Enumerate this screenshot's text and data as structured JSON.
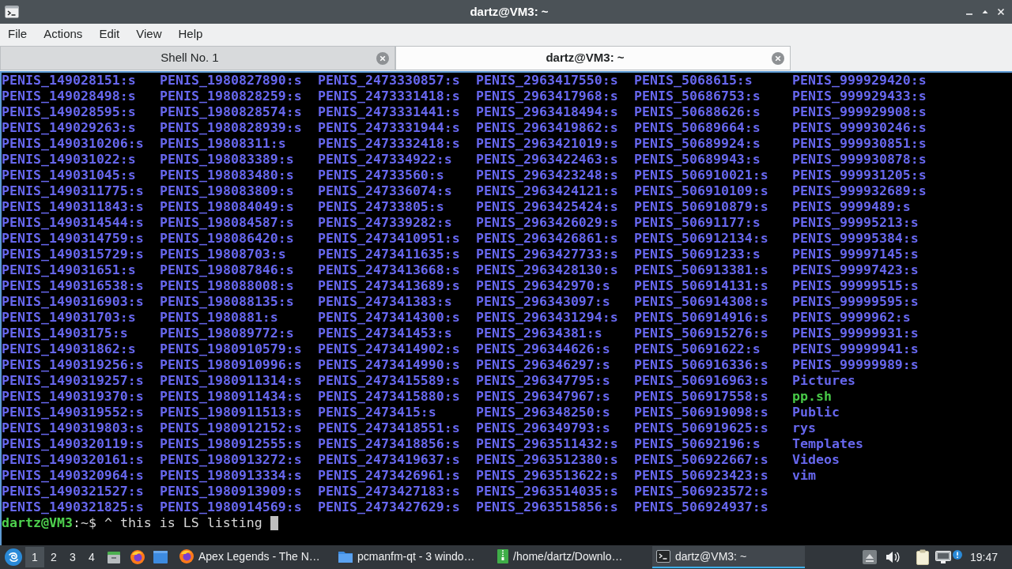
{
  "window": {
    "title": "dartz@VM3: ~"
  },
  "menu": [
    "File",
    "Actions",
    "Edit",
    "View",
    "Help"
  ],
  "tabs": [
    {
      "label": "Shell No. 1",
      "selected": false
    },
    {
      "label": "dartz@VM3: ~",
      "selected": true
    }
  ],
  "terminal": {
    "columns": [
      [
        {
          "name": "PENIS_149028151:s",
          "kind": "dir"
        },
        {
          "name": "PENIS_149028498:s",
          "kind": "dir"
        },
        {
          "name": "PENIS_149028595:s",
          "kind": "dir"
        },
        {
          "name": "PENIS_149029263:s",
          "kind": "dir"
        },
        {
          "name": "PENIS_1490310206:s",
          "kind": "dir"
        },
        {
          "name": "PENIS_149031022:s",
          "kind": "dir"
        },
        {
          "name": "PENIS_149031045:s",
          "kind": "dir"
        },
        {
          "name": "PENIS_1490311775:s",
          "kind": "dir"
        },
        {
          "name": "PENIS_1490311843:s",
          "kind": "dir"
        },
        {
          "name": "PENIS_1490314544:s",
          "kind": "dir"
        },
        {
          "name": "PENIS_1490314759:s",
          "kind": "dir"
        },
        {
          "name": "PENIS_1490315729:s",
          "kind": "dir"
        },
        {
          "name": "PENIS_149031651:s",
          "kind": "dir"
        },
        {
          "name": "PENIS_1490316538:s",
          "kind": "dir"
        },
        {
          "name": "PENIS_1490316903:s",
          "kind": "dir"
        },
        {
          "name": "PENIS_149031703:s",
          "kind": "dir"
        },
        {
          "name": "PENIS_14903175:s",
          "kind": "dir"
        },
        {
          "name": "PENIS_149031862:s",
          "kind": "dir"
        },
        {
          "name": "PENIS_1490319256:s",
          "kind": "dir"
        },
        {
          "name": "PENIS_1490319257:s",
          "kind": "dir"
        },
        {
          "name": "PENIS_1490319370:s",
          "kind": "dir"
        },
        {
          "name": "PENIS_1490319552:s",
          "kind": "dir"
        },
        {
          "name": "PENIS_1490319803:s",
          "kind": "dir"
        },
        {
          "name": "PENIS_1490320119:s",
          "kind": "dir"
        },
        {
          "name": "PENIS_1490320161:s",
          "kind": "dir"
        },
        {
          "name": "PENIS_1490320964:s",
          "kind": "dir"
        },
        {
          "name": "PENIS_1490321527:s",
          "kind": "dir"
        },
        {
          "name": "PENIS_1490321825:s",
          "kind": "dir"
        }
      ],
      [
        {
          "name": "PENIS_1980827890:s",
          "kind": "dir"
        },
        {
          "name": "PENIS_1980828259:s",
          "kind": "dir"
        },
        {
          "name": "PENIS_1980828574:s",
          "kind": "dir"
        },
        {
          "name": "PENIS_1980828939:s",
          "kind": "dir"
        },
        {
          "name": "PENIS_19808311:s",
          "kind": "dir"
        },
        {
          "name": "PENIS_198083389:s",
          "kind": "dir"
        },
        {
          "name": "PENIS_198083480:s",
          "kind": "dir"
        },
        {
          "name": "PENIS_198083809:s",
          "kind": "dir"
        },
        {
          "name": "PENIS_198084049:s",
          "kind": "dir"
        },
        {
          "name": "PENIS_198084587:s",
          "kind": "dir"
        },
        {
          "name": "PENIS_198086420:s",
          "kind": "dir"
        },
        {
          "name": "PENIS_19808703:s",
          "kind": "dir"
        },
        {
          "name": "PENIS_198087846:s",
          "kind": "dir"
        },
        {
          "name": "PENIS_198088008:s",
          "kind": "dir"
        },
        {
          "name": "PENIS_198088135:s",
          "kind": "dir"
        },
        {
          "name": "PENIS_1980881:s",
          "kind": "dir"
        },
        {
          "name": "PENIS_198089772:s",
          "kind": "dir"
        },
        {
          "name": "PENIS_1980910579:s",
          "kind": "dir"
        },
        {
          "name": "PENIS_1980910996:s",
          "kind": "dir"
        },
        {
          "name": "PENIS_1980911314:s",
          "kind": "dir"
        },
        {
          "name": "PENIS_1980911434:s",
          "kind": "dir"
        },
        {
          "name": "PENIS_1980911513:s",
          "kind": "dir"
        },
        {
          "name": "PENIS_1980912152:s",
          "kind": "dir"
        },
        {
          "name": "PENIS_1980912555:s",
          "kind": "dir"
        },
        {
          "name": "PENIS_1980913272:s",
          "kind": "dir"
        },
        {
          "name": "PENIS_1980913334:s",
          "kind": "dir"
        },
        {
          "name": "PENIS_1980913909:s",
          "kind": "dir"
        },
        {
          "name": "PENIS_1980914569:s",
          "kind": "dir"
        }
      ],
      [
        {
          "name": "PENIS_2473330857:s",
          "kind": "dir"
        },
        {
          "name": "PENIS_2473331418:s",
          "kind": "dir"
        },
        {
          "name": "PENIS_2473331441:s",
          "kind": "dir"
        },
        {
          "name": "PENIS_2473331944:s",
          "kind": "dir"
        },
        {
          "name": "PENIS_2473332418:s",
          "kind": "dir"
        },
        {
          "name": "PENIS_247334922:s",
          "kind": "dir"
        },
        {
          "name": "PENIS_24733560:s",
          "kind": "dir"
        },
        {
          "name": "PENIS_247336074:s",
          "kind": "dir"
        },
        {
          "name": "PENIS_24733805:s",
          "kind": "dir"
        },
        {
          "name": "PENIS_247339282:s",
          "kind": "dir"
        },
        {
          "name": "PENIS_2473410951:s",
          "kind": "dir"
        },
        {
          "name": "PENIS_2473411635:s",
          "kind": "dir"
        },
        {
          "name": "PENIS_2473413668:s",
          "kind": "dir"
        },
        {
          "name": "PENIS_2473413689:s",
          "kind": "dir"
        },
        {
          "name": "PENIS_247341383:s",
          "kind": "dir"
        },
        {
          "name": "PENIS_2473414300:s",
          "kind": "dir"
        },
        {
          "name": "PENIS_247341453:s",
          "kind": "dir"
        },
        {
          "name": "PENIS_2473414902:s",
          "kind": "dir"
        },
        {
          "name": "PENIS_2473414990:s",
          "kind": "dir"
        },
        {
          "name": "PENIS_2473415589:s",
          "kind": "dir"
        },
        {
          "name": "PENIS_2473415880:s",
          "kind": "dir"
        },
        {
          "name": "PENIS_2473415:s",
          "kind": "dir"
        },
        {
          "name": "PENIS_2473418551:s",
          "kind": "dir"
        },
        {
          "name": "PENIS_2473418856:s",
          "kind": "dir"
        },
        {
          "name": "PENIS_2473419637:s",
          "kind": "dir"
        },
        {
          "name": "PENIS_2473426961:s",
          "kind": "dir"
        },
        {
          "name": "PENIS_2473427183:s",
          "kind": "dir"
        },
        {
          "name": "PENIS_2473427629:s",
          "kind": "dir"
        }
      ],
      [
        {
          "name": "PENIS_2963417550:s",
          "kind": "dir"
        },
        {
          "name": "PENIS_2963417968:s",
          "kind": "dir"
        },
        {
          "name": "PENIS_2963418494:s",
          "kind": "dir"
        },
        {
          "name": "PENIS_2963419862:s",
          "kind": "dir"
        },
        {
          "name": "PENIS_2963421019:s",
          "kind": "dir"
        },
        {
          "name": "PENIS_2963422463:s",
          "kind": "dir"
        },
        {
          "name": "PENIS_2963423248:s",
          "kind": "dir"
        },
        {
          "name": "PENIS_2963424121:s",
          "kind": "dir"
        },
        {
          "name": "PENIS_2963425424:s",
          "kind": "dir"
        },
        {
          "name": "PENIS_2963426029:s",
          "kind": "dir"
        },
        {
          "name": "PENIS_2963426861:s",
          "kind": "dir"
        },
        {
          "name": "PENIS_2963427733:s",
          "kind": "dir"
        },
        {
          "name": "PENIS_2963428130:s",
          "kind": "dir"
        },
        {
          "name": "PENIS_296342970:s",
          "kind": "dir"
        },
        {
          "name": "PENIS_296343097:s",
          "kind": "dir"
        },
        {
          "name": "PENIS_2963431294:s",
          "kind": "dir"
        },
        {
          "name": "PENIS_29634381:s",
          "kind": "dir"
        },
        {
          "name": "PENIS_296344626:s",
          "kind": "dir"
        },
        {
          "name": "PENIS_296346297:s",
          "kind": "dir"
        },
        {
          "name": "PENIS_296347795:s",
          "kind": "dir"
        },
        {
          "name": "PENIS_296347967:s",
          "kind": "dir"
        },
        {
          "name": "PENIS_296348250:s",
          "kind": "dir"
        },
        {
          "name": "PENIS_296349793:s",
          "kind": "dir"
        },
        {
          "name": "PENIS_2963511432:s",
          "kind": "dir"
        },
        {
          "name": "PENIS_2963512380:s",
          "kind": "dir"
        },
        {
          "name": "PENIS_2963513622:s",
          "kind": "dir"
        },
        {
          "name": "PENIS_2963514035:s",
          "kind": "dir"
        },
        {
          "name": "PENIS_2963515856:s",
          "kind": "dir"
        }
      ],
      [
        {
          "name": "PENIS_5068615:s",
          "kind": "dir"
        },
        {
          "name": "PENIS_50686753:s",
          "kind": "dir"
        },
        {
          "name": "PENIS_50688626:s",
          "kind": "dir"
        },
        {
          "name": "PENIS_50689664:s",
          "kind": "dir"
        },
        {
          "name": "PENIS_50689924:s",
          "kind": "dir"
        },
        {
          "name": "PENIS_50689943:s",
          "kind": "dir"
        },
        {
          "name": "PENIS_506910021:s",
          "kind": "dir"
        },
        {
          "name": "PENIS_506910109:s",
          "kind": "dir"
        },
        {
          "name": "PENIS_506910879:s",
          "kind": "dir"
        },
        {
          "name": "PENIS_50691177:s",
          "kind": "dir"
        },
        {
          "name": "PENIS_506912134:s",
          "kind": "dir"
        },
        {
          "name": "PENIS_50691233:s",
          "kind": "dir"
        },
        {
          "name": "PENIS_506913381:s",
          "kind": "dir"
        },
        {
          "name": "PENIS_506914131:s",
          "kind": "dir"
        },
        {
          "name": "PENIS_506914308:s",
          "kind": "dir"
        },
        {
          "name": "PENIS_506914916:s",
          "kind": "dir"
        },
        {
          "name": "PENIS_506915276:s",
          "kind": "dir"
        },
        {
          "name": "PENIS_50691622:s",
          "kind": "dir"
        },
        {
          "name": "PENIS_506916336:s",
          "kind": "dir"
        },
        {
          "name": "PENIS_506916963:s",
          "kind": "dir"
        },
        {
          "name": "PENIS_506917558:s",
          "kind": "dir"
        },
        {
          "name": "PENIS_506919098:s",
          "kind": "dir"
        },
        {
          "name": "PENIS_506919625:s",
          "kind": "dir"
        },
        {
          "name": "PENIS_50692196:s",
          "kind": "dir"
        },
        {
          "name": "PENIS_506922667:s",
          "kind": "dir"
        },
        {
          "name": "PENIS_506923423:s",
          "kind": "dir"
        },
        {
          "name": "PENIS_506923572:s",
          "kind": "dir"
        },
        {
          "name": "PENIS_506924937:s",
          "kind": "dir"
        }
      ],
      [
        {
          "name": "PENIS_999929420:s",
          "kind": "dir"
        },
        {
          "name": "PENIS_999929433:s",
          "kind": "dir"
        },
        {
          "name": "PENIS_999929908:s",
          "kind": "dir"
        },
        {
          "name": "PENIS_999930246:s",
          "kind": "dir"
        },
        {
          "name": "PENIS_999930851:s",
          "kind": "dir"
        },
        {
          "name": "PENIS_999930878:s",
          "kind": "dir"
        },
        {
          "name": "PENIS_999931205:s",
          "kind": "dir"
        },
        {
          "name": "PENIS_999932689:s",
          "kind": "dir"
        },
        {
          "name": "PENIS_9999489:s",
          "kind": "dir"
        },
        {
          "name": "PENIS_99995213:s",
          "kind": "dir"
        },
        {
          "name": "PENIS_99995384:s",
          "kind": "dir"
        },
        {
          "name": "PENIS_99997145:s",
          "kind": "dir"
        },
        {
          "name": "PENIS_99997423:s",
          "kind": "dir"
        },
        {
          "name": "PENIS_99999515:s",
          "kind": "dir"
        },
        {
          "name": "PENIS_99999595:s",
          "kind": "dir"
        },
        {
          "name": "PENIS_9999962:s",
          "kind": "dir"
        },
        {
          "name": "PENIS_99999931:s",
          "kind": "dir"
        },
        {
          "name": "PENIS_99999941:s",
          "kind": "dir"
        },
        {
          "name": "PENIS_99999989:s",
          "kind": "dir"
        },
        {
          "name": "Pictures",
          "kind": "dir"
        },
        {
          "name": "pp.sh",
          "kind": "exec"
        },
        {
          "name": "Public",
          "kind": "dir"
        },
        {
          "name": "rys",
          "kind": "dir"
        },
        {
          "name": "Templates",
          "kind": "dir"
        },
        {
          "name": "Videos",
          "kind": "dir"
        },
        {
          "name": "vim",
          "kind": "dir"
        }
      ]
    ],
    "prompt": {
      "user_host": "dartz@VM3",
      "path": ":~$",
      "command": "^ this is LS listing"
    }
  },
  "taskbar": {
    "workspaces": [
      {
        "label": "1",
        "selected": true
      },
      {
        "label": "2",
        "selected": false
      },
      {
        "label": "3",
        "selected": false
      },
      {
        "label": "4",
        "selected": false
      }
    ],
    "tasks": [
      {
        "label": "Apex Legends - The N…",
        "kind": "browser",
        "selected": false
      },
      {
        "label": "pcmanfm-qt - 3 windo…",
        "kind": "folder",
        "selected": false
      },
      {
        "label": "/home/dartz/Downlo…",
        "kind": "archive",
        "selected": false
      },
      {
        "label": "dartz@VM3: ~",
        "kind": "terminal",
        "selected": true
      }
    ],
    "clock": "19:47"
  }
}
